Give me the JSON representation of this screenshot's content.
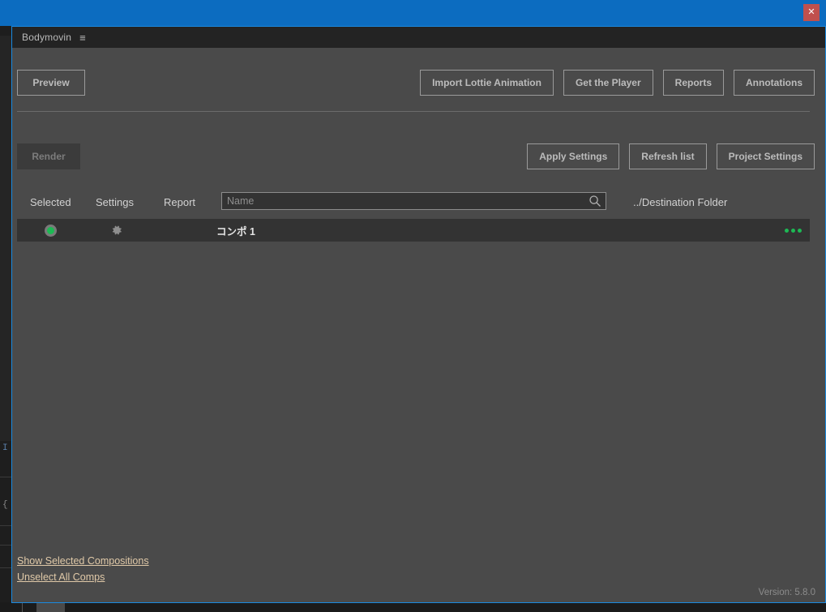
{
  "window": {
    "close_label": "✕",
    "accent_color": "#0c6cc0",
    "border_color": "#1a8ae0",
    "close_color": "#c0504d"
  },
  "panel": {
    "title": "Bodymovin",
    "menu_icon": "≡"
  },
  "toolbar_top": {
    "preview_label": "Preview",
    "buttons": [
      {
        "label": "Import Lottie Animation"
      },
      {
        "label": "Get the Player"
      },
      {
        "label": "Reports"
      },
      {
        "label": "Annotations"
      }
    ]
  },
  "toolbar_second": {
    "render_label": "Render",
    "render_enabled": false,
    "buttons": [
      {
        "label": "Apply Settings"
      },
      {
        "label": "Refresh list"
      },
      {
        "label": "Project Settings"
      }
    ]
  },
  "list_header": {
    "col_selected": "Selected",
    "col_settings": "Settings",
    "col_report": "Report",
    "destination_folder": "../Destination Folder"
  },
  "search": {
    "value": "",
    "placeholder": "Name",
    "icon": "search-icon"
  },
  "compositions": [
    {
      "name": "コンポ 1",
      "selected": true,
      "selected_color": "#1db954",
      "settings_icon": "gear-icon",
      "more_icon": "ellipsis-icon"
    }
  ],
  "footer": {
    "links": [
      {
        "label": "Show Selected Compositions"
      },
      {
        "label": "Unselect All Comps"
      }
    ],
    "version": "Version: 5.8.0"
  },
  "background": {
    "glyph_cursor": "I",
    "glyph_brace": "{"
  }
}
